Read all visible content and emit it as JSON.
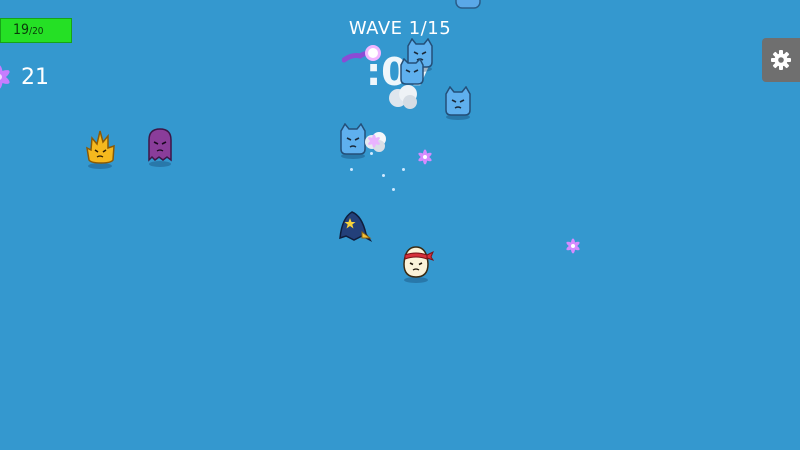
{
  "hud": {
    "hp_current": "19",
    "hp_max": "/20",
    "gems": "21",
    "wave": "WAVE 1/15",
    "timer": ":07"
  },
  "colors": {
    "background": "#3498cf",
    "hp_fill": "#25e025",
    "settings_bg": "#6f6f6f",
    "gem": "#c77dff"
  },
  "icons": {
    "settings": "gear-icon",
    "gem": "gem-icon"
  }
}
